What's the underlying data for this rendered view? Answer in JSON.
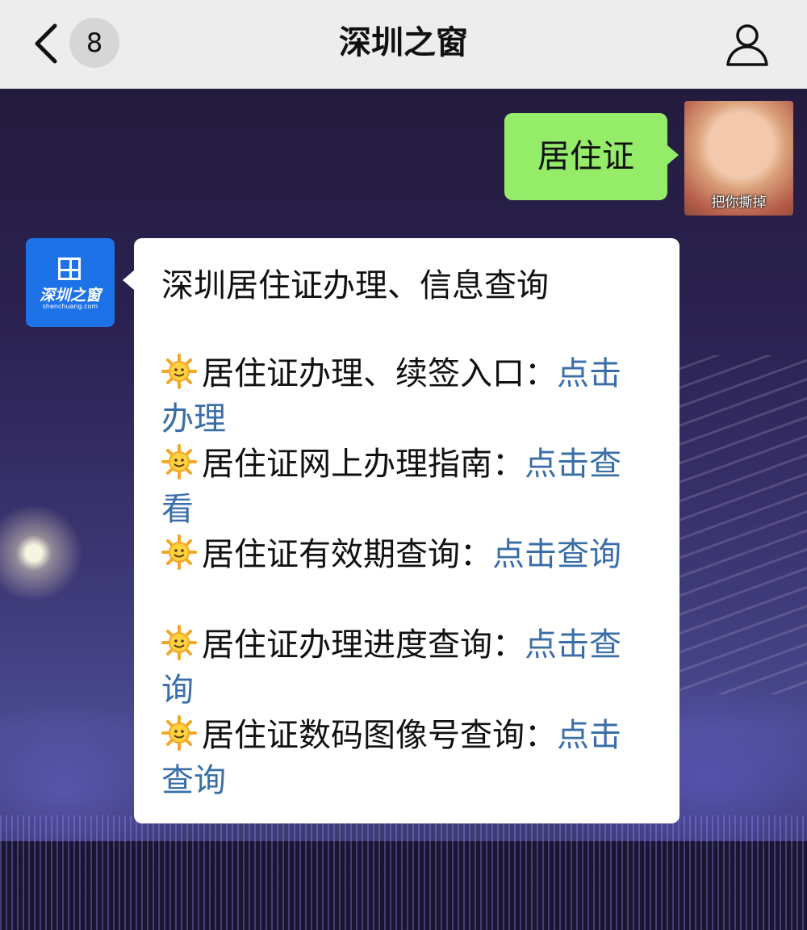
{
  "header": {
    "title": "深圳之窗",
    "unread_count": "8"
  },
  "me": {
    "message": "居住证",
    "avatar_caption": "把你撕掉"
  },
  "official": {
    "logo_name": "深圳之窗",
    "logo_domain": "shenchuang.com",
    "message_title": "深圳居住证办理、信息查询",
    "items": [
      {
        "label": "居住证办理、续签入口：",
        "link": "点击办理"
      },
      {
        "label": "居住证网上办理指南：",
        "link": "点击查看"
      },
      {
        "label": "居住证有效期查询：",
        "link": "点击查询"
      },
      {
        "label": "居住证办理进度查询：",
        "link": "点击查询"
      },
      {
        "label": "居住证数码图像号查询：",
        "link": "点击查询"
      }
    ]
  },
  "colors": {
    "header_bg": "#ededed",
    "my_bubble": "#95ec69",
    "official_bubble": "#ffffff",
    "link": "#3a6ea8",
    "official_avatar_bg": "#1d72e8"
  },
  "icons": [
    "back-chevron-icon",
    "profile-icon",
    "sun-emoji-icon",
    "grid-logo-icon"
  ]
}
